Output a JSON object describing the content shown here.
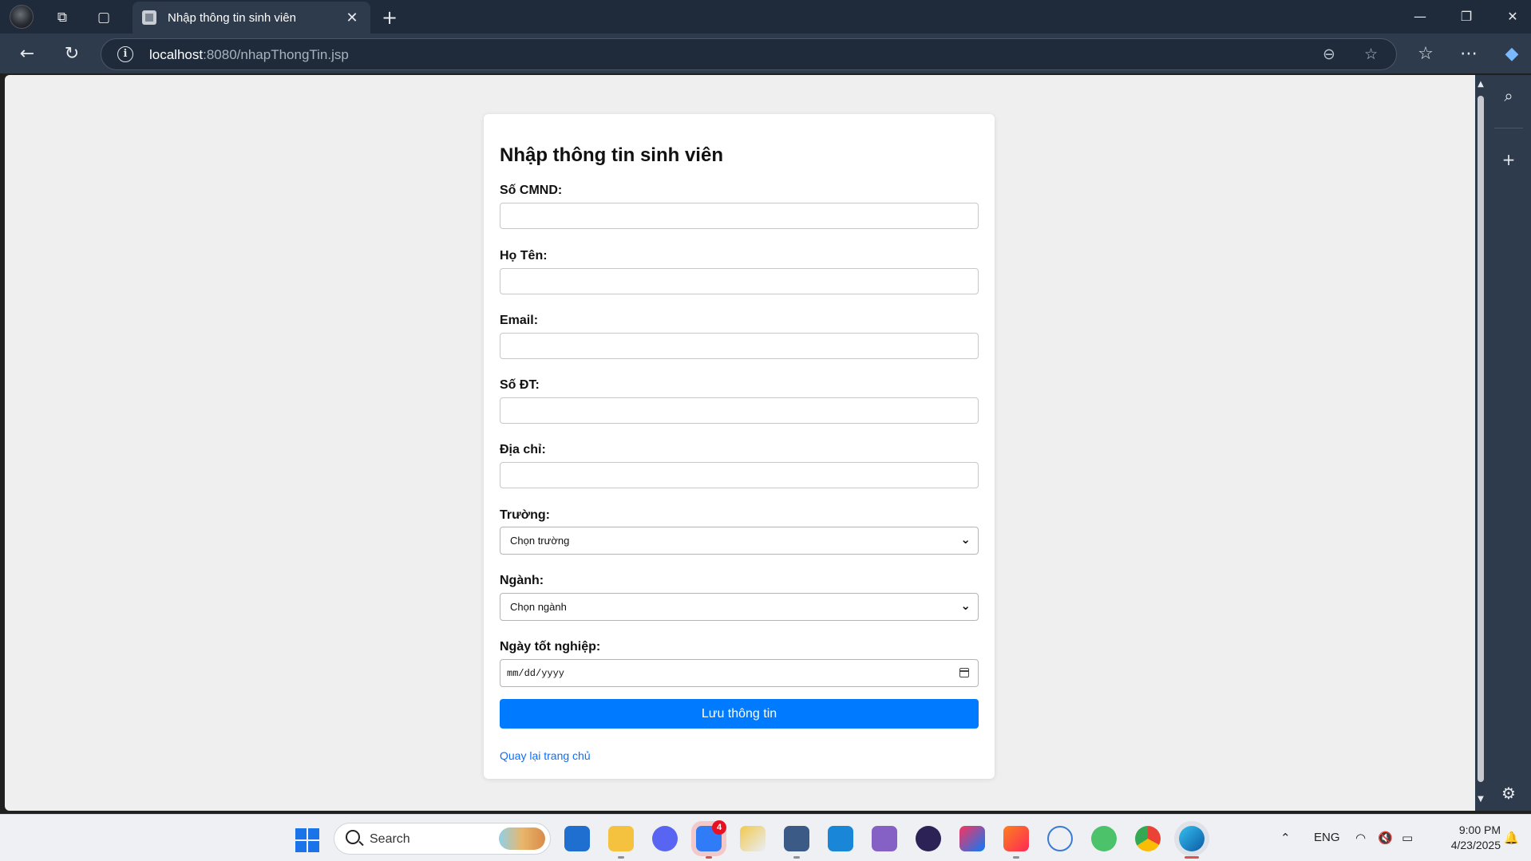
{
  "browser": {
    "tab_title": "Nhập thông tin sinh viên",
    "url_host": "localhost",
    "url_rest": ":8080/nhapThongTin.jsp"
  },
  "form": {
    "title": "Nhập thông tin sinh viên",
    "cmnd_label": "Số CMND:",
    "name_label": "Họ Tên:",
    "email_label": "Email:",
    "phone_label": "Số ĐT:",
    "address_label": "Địa chỉ:",
    "school_label": "Trường:",
    "school_selected": "Chọn trường",
    "major_label": "Ngành:",
    "major_selected": "Chọn ngành",
    "grad_date_label": "Ngày tốt nghiệp:",
    "grad_date_placeholder": "mm/dd/yyyy",
    "save_button": "Lưu thông tin",
    "back_link": "Quay lại trang chủ"
  },
  "taskbar": {
    "search_label": "Search",
    "zalo_badge": "4",
    "language": "ENG",
    "time": "9:00 PM",
    "date": "4/23/2025"
  },
  "colors": {
    "primary_button": "#007bff",
    "link": "#0d6efd",
    "page_bg": "#efefef",
    "browser_chrome": "#2e3b4c"
  }
}
